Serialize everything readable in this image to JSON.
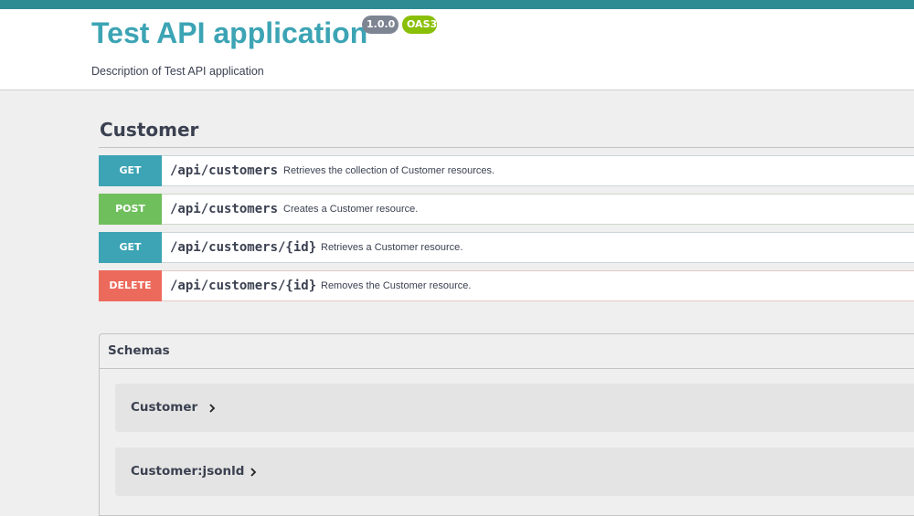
{
  "info": {
    "title": "Test API application",
    "version": "1.0.0",
    "oas": "OAS3",
    "description": "Description of Test API application"
  },
  "tag": {
    "name": "Customer"
  },
  "operations": [
    {
      "method": "GET",
      "path": "/api/customers",
      "summary": "Retrieves the collection of Customer resources."
    },
    {
      "method": "POST",
      "path": "/api/customers",
      "summary": "Creates a Customer resource."
    },
    {
      "method": "GET",
      "path": "/api/customers/{id}",
      "summary": "Retrieves a Customer resource."
    },
    {
      "method": "DELETE",
      "path": "/api/customers/{id}",
      "summary": "Removes the Customer resource."
    }
  ],
  "schemas": {
    "title": "Schemas",
    "models": [
      {
        "name": "Customer",
        "icon": "chevron-right-icon"
      },
      {
        "name": "Customer:jsonld",
        "icon": "chevron-right-icon"
      }
    ]
  },
  "colors": {
    "topbar": "#2e8a93",
    "get": "#3ca4b4",
    "post": "#6fbf5c",
    "delete": "#ec6a5c",
    "version_badge": "#7d8492",
    "oas_badge": "#89bf04"
  }
}
